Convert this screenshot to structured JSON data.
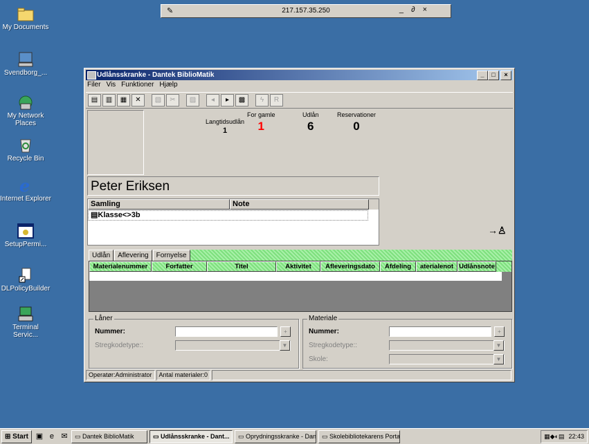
{
  "desktop": {
    "icons": [
      {
        "label": "My Documents",
        "icon": "folder-icon"
      },
      {
        "label": "Svendborg_...",
        "icon": "computer-icon"
      },
      {
        "label": "My Network Places",
        "icon": "network-icon"
      },
      {
        "label": "Recycle Bin",
        "icon": "recycle-bin-icon"
      },
      {
        "label": "Internet Explorer",
        "icon": "ie-icon"
      },
      {
        "label": "SetupPermi...",
        "icon": "setup-icon"
      },
      {
        "label": "DLPolicyBuilder",
        "icon": "shortcut-icon"
      },
      {
        "label": "Terminal Servic...",
        "icon": "terminal-icon"
      }
    ]
  },
  "remote_bar": {
    "ip": "217.157.35.250",
    "controls": "_ ∂ ×"
  },
  "window": {
    "title": "Udlånsskranke - Dantek BiblioMatik",
    "menu": [
      "Filer",
      "Vis",
      "Funktioner",
      "Hjælp"
    ],
    "stats": {
      "langtid_label": "Langtidsudlån",
      "langtid_value": "1",
      "forgamle_label": "For gamle",
      "forgamle_value": "1",
      "udlan_label": "Udlån",
      "udlan_value": "6",
      "res_label": "Reservationer",
      "res_value": "0"
    },
    "patron_name": "Peter Eriksen",
    "list": {
      "headers": [
        "Samling",
        "Note"
      ],
      "rows": [
        "Klasse<>3b"
      ]
    },
    "tabs": [
      "Udlån",
      "Aflevering",
      "Fornyelse"
    ],
    "grid_headers": [
      "Materialenummer",
      "Forfatter",
      "Titel",
      "Aktivitet",
      "Afleveringsdato",
      "Afdeling",
      "aterialenot",
      "Udlånsnote"
    ],
    "laaner": {
      "group": "Låner",
      "nummer_label": "Nummer:",
      "stregkode_label": "Stregkodetype::"
    },
    "materiale": {
      "group": "Materiale",
      "nummer_label": "Nummer:",
      "stregkode_label": "Stregkodetype::",
      "skole_label": "Skole:"
    },
    "status": {
      "operator": "Operatør:Administrator",
      "antal": "Antal materialer:0"
    }
  },
  "taskbar": {
    "start": "Start",
    "tasks": [
      "Dantek BiblioMatik",
      "Udlånsskranke - Dant...",
      "Oprydningsskranke - Dan...",
      "Skolebibliotekarens Porta..."
    ],
    "clock": "22:43"
  },
  "colors": {
    "desktop": "#3a6ea5",
    "titlebar": "#0a246a",
    "grid_header": "#7ee07e",
    "alert": "#ff0000"
  }
}
